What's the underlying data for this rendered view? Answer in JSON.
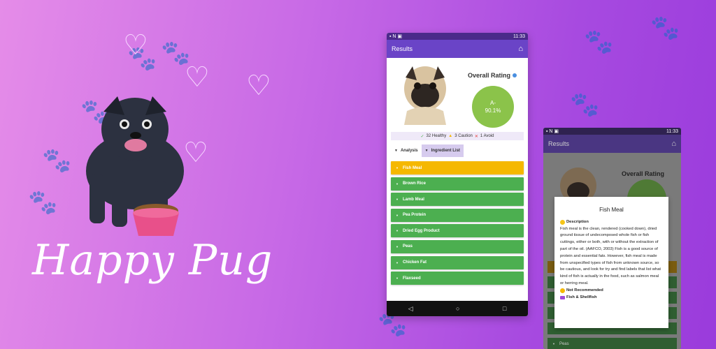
{
  "promo": {
    "title": "Happy Pug"
  },
  "phone1": {
    "status": {
      "left_icons": "▪ N ▣",
      "time": "11:33"
    },
    "appbar": {
      "title": "Results",
      "home_icon": "home-icon"
    },
    "rating": {
      "label": "Overall Rating",
      "grade": "A-",
      "percent": "90.1%"
    },
    "summary": {
      "healthy": "32 Healthy",
      "caution": "3 Caution",
      "avoid": "1 Avoid"
    },
    "tabs": [
      {
        "label": "Analysis"
      },
      {
        "label": "Ingredient List"
      }
    ],
    "ingredients": [
      {
        "label": "Fish Meal",
        "color": "#f5b800"
      },
      {
        "label": "Brown Rice",
        "color": "#4caf50"
      },
      {
        "label": "Lamb Meal",
        "color": "#4caf50"
      },
      {
        "label": "Pea Protein",
        "color": "#4caf50"
      },
      {
        "label": "Dried Egg Product",
        "color": "#4caf50"
      },
      {
        "label": "Peas",
        "color": "#4caf50"
      },
      {
        "label": "Chicken Fat",
        "color": "#4caf50"
      },
      {
        "label": "Flaxseed",
        "color": "#4caf50"
      }
    ],
    "nav": {
      "back": "◁",
      "home": "○",
      "recent": "□"
    }
  },
  "phone2": {
    "status": {
      "time": "11:33"
    },
    "appbar": {
      "title": "Results"
    },
    "rating_label": "Overall Rating",
    "visible_row": "Peas",
    "modal": {
      "title": "Fish Meal",
      "description_heading": "Description",
      "description": "Fish meal is the clean, rendered (cooked down), dried ground tissue of undecomposed whole fish or fish cuttings, either or both, with or without the extraction of part of the oil. (AAFCO, 2003) Fish is a good source of protein and essential fats. However, fish meal is made from unspecified types of fish from unknown source, so be cautious, and look for try and find labels that list what kind of fish is actually in the food, such as salmon meal or herring meal.",
      "recommendation": "Not Recommended",
      "category": "Fish & Shellfish"
    }
  }
}
